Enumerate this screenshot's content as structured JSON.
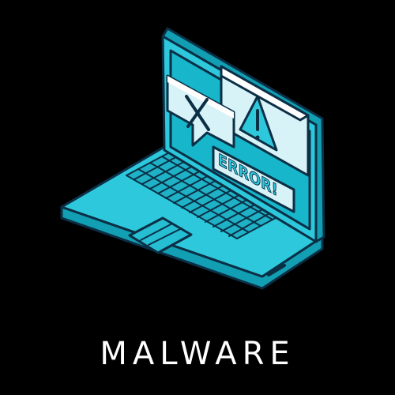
{
  "caption": "MALWARE",
  "error_badge": "ERROR!",
  "icons": [
    "laptop-icon",
    "close-icon",
    "warning-icon"
  ],
  "colors": {
    "background": "#000000",
    "body": "#2ec8dc",
    "screen": "#17b6cb",
    "keys": "#1fb1c6",
    "outline": "#0b2f45",
    "popup": "#d8f3f8",
    "caption": "#ffffff"
  }
}
